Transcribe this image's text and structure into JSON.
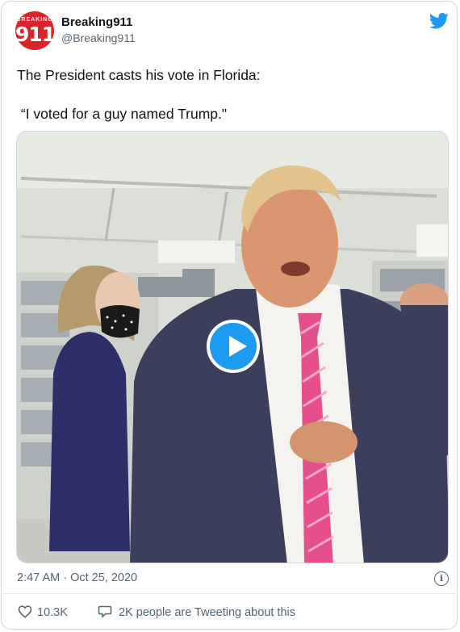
{
  "author": {
    "display_name": "Breaking911",
    "handle": "@Breaking911",
    "avatar_top_text": "BREAKING",
    "avatar_main_text": "911"
  },
  "icons": {
    "logo": "twitter-bird-icon",
    "play": "play-icon",
    "info": "info-icon",
    "like": "heart-icon",
    "conversation": "speech-bubble-icon"
  },
  "tweet": {
    "text": "The President casts his vote in Florida:\n\n “I voted for a guy named Trump.\"",
    "timestamp": "2:47 AM · Oct 25, 2020"
  },
  "stats": {
    "likes": "10.3K",
    "conversation": "2K people are Tweeting about this"
  },
  "colors": {
    "accent": "#1d9bf0",
    "avatar_bg": "#d9252a",
    "secondary_text": "#536471"
  }
}
